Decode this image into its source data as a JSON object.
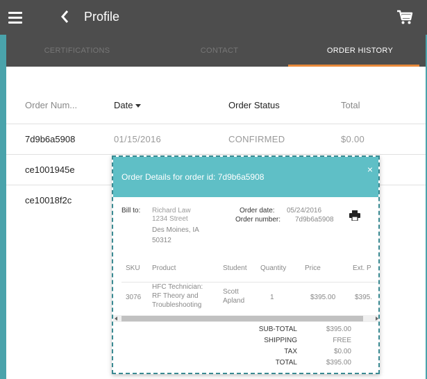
{
  "header": {
    "title": "Profile"
  },
  "tabs": [
    {
      "label": "CERTIFICATIONS"
    },
    {
      "label": "CONTACT"
    },
    {
      "label": "ORDER HISTORY"
    }
  ],
  "orders_table": {
    "columns": [
      "Order Num...",
      "Date",
      "Order Status",
      "Total"
    ],
    "rows": [
      {
        "order_num": "7d9b6a5908",
        "date": "01/15/2016",
        "status": "CONFIRMED",
        "total": "$0.00"
      },
      {
        "order_num": "ce1001945e"
      },
      {
        "order_num": "ce10018f2c"
      }
    ]
  },
  "modal": {
    "title": "Order Details for order id: 7d9b6a5908",
    "close": "×",
    "bill_to_label": "Bill to:",
    "bill_to": {
      "name": "Richard Law",
      "street": "1234 Street",
      "city": "Des Moines, IA",
      "zip": "50312"
    },
    "order_date_label": "Order date:",
    "order_date": "05/24/2016",
    "order_number_label": "Order number:",
    "order_number": "7d9b6a5908",
    "items_columns": [
      "SKU",
      "Product",
      "Student",
      "Quantity",
      "Price",
      "Ext. P"
    ],
    "items": [
      {
        "sku": "3076",
        "product_line1": "HFC Technician:",
        "product_line2": "RF Theory and",
        "product_line3": "Troubleshooting",
        "student_line1": "Scott",
        "student_line2": "Apland",
        "quantity": "1",
        "price": "$395.00",
        "ext_price": "$395."
      }
    ],
    "totals": [
      {
        "label": "SUB-TOTAL",
        "value": "$395.00"
      },
      {
        "label": "SHIPPING",
        "value": "FREE"
      },
      {
        "label": "TAX",
        "value": "$0.00"
      },
      {
        "label": "TOTAL",
        "value": "$395.00"
      }
    ]
  }
}
